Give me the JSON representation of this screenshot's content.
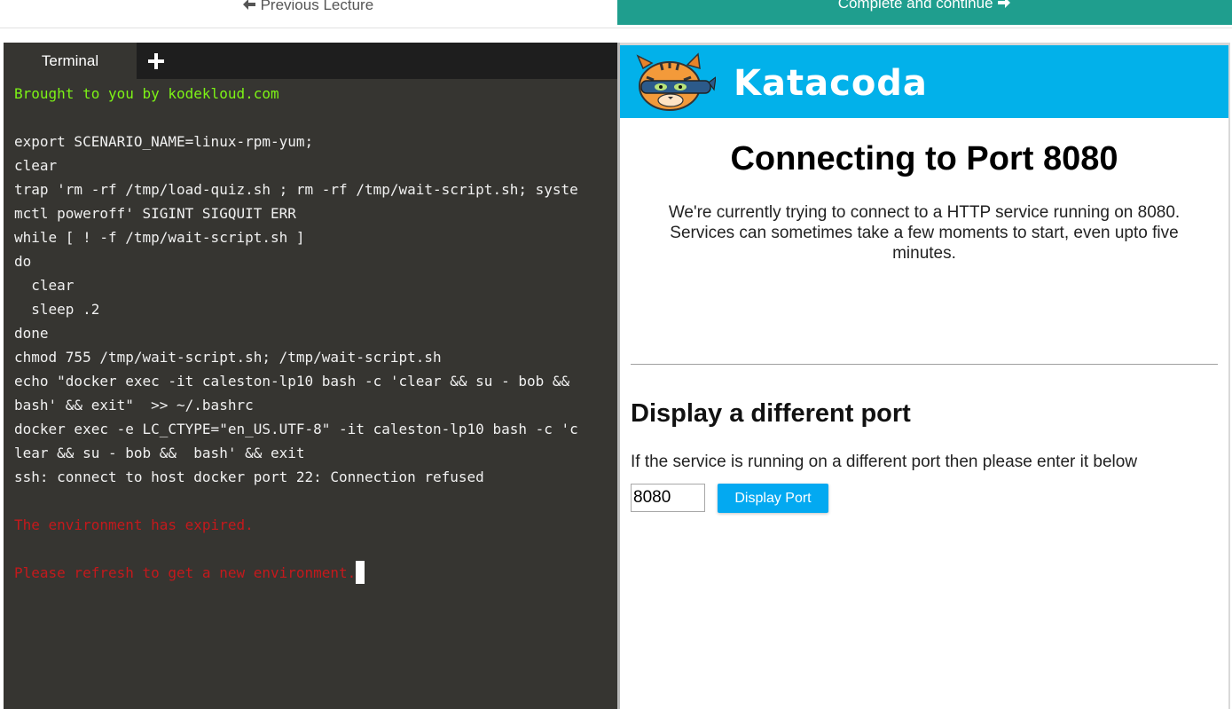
{
  "nav": {
    "previous_label": "Previous Lecture",
    "next_label": "Complete and continue"
  },
  "terminal": {
    "tab_label": "Terminal",
    "lines": [
      {
        "text": "Brought to you by kodekloud.com",
        "color": "green"
      },
      {
        "text": "",
        "color": "default"
      },
      {
        "text": "export SCENARIO_NAME=linux-rpm-yum;",
        "color": "default"
      },
      {
        "text": "clear",
        "color": "default"
      },
      {
        "text": "trap 'rm -rf /tmp/load-quiz.sh ; rm -rf /tmp/wait-script.sh; syste",
        "color": "default"
      },
      {
        "text": "mctl poweroff' SIGINT SIGQUIT ERR",
        "color": "default"
      },
      {
        "text": "while [ ! -f /tmp/wait-script.sh ]",
        "color": "default"
      },
      {
        "text": "do",
        "color": "default"
      },
      {
        "text": "  clear",
        "color": "default"
      },
      {
        "text": "  sleep .2",
        "color": "default"
      },
      {
        "text": "done",
        "color": "default"
      },
      {
        "text": "chmod 755 /tmp/wait-script.sh; /tmp/wait-script.sh",
        "color": "default"
      },
      {
        "text": "echo \"docker exec -it caleston-lp10 bash -c 'clear && su - bob &&",
        "color": "default"
      },
      {
        "text": "bash' && exit\"  >> ~/.bashrc",
        "color": "default"
      },
      {
        "text": "docker exec -e LC_CTYPE=\"en_US.UTF-8\" -it caleston-lp10 bash -c 'c",
        "color": "default"
      },
      {
        "text": "lear && su - bob &&  bash' && exit",
        "color": "default"
      },
      {
        "text": "ssh: connect to host docker port 22: Connection refused",
        "color": "default"
      },
      {
        "text": "",
        "color": "default"
      },
      {
        "text": "The environment has expired.",
        "color": "red"
      },
      {
        "text": "",
        "color": "default"
      },
      {
        "text": "Please refresh to get a new environment.",
        "color": "red",
        "cursor": true
      }
    ]
  },
  "katacoda": {
    "brand": "Katacoda",
    "title": "Connecting to Port 8080",
    "description": "We're currently trying to connect to a HTTP service running on 8080. Services can sometimes take a few moments to start, even upto five minutes.",
    "different_port_heading": "Display a different port",
    "different_port_text": "If the service is running on a different port then please enter it below",
    "port_value": "8080",
    "display_button_label": "Display Port"
  },
  "colors": {
    "teal_button": "#1f9e8e",
    "terminal_bg": "#363531",
    "katacoda_blue": "#02b1ea",
    "green_text": "#7df316",
    "red_text": "#c4191c"
  }
}
